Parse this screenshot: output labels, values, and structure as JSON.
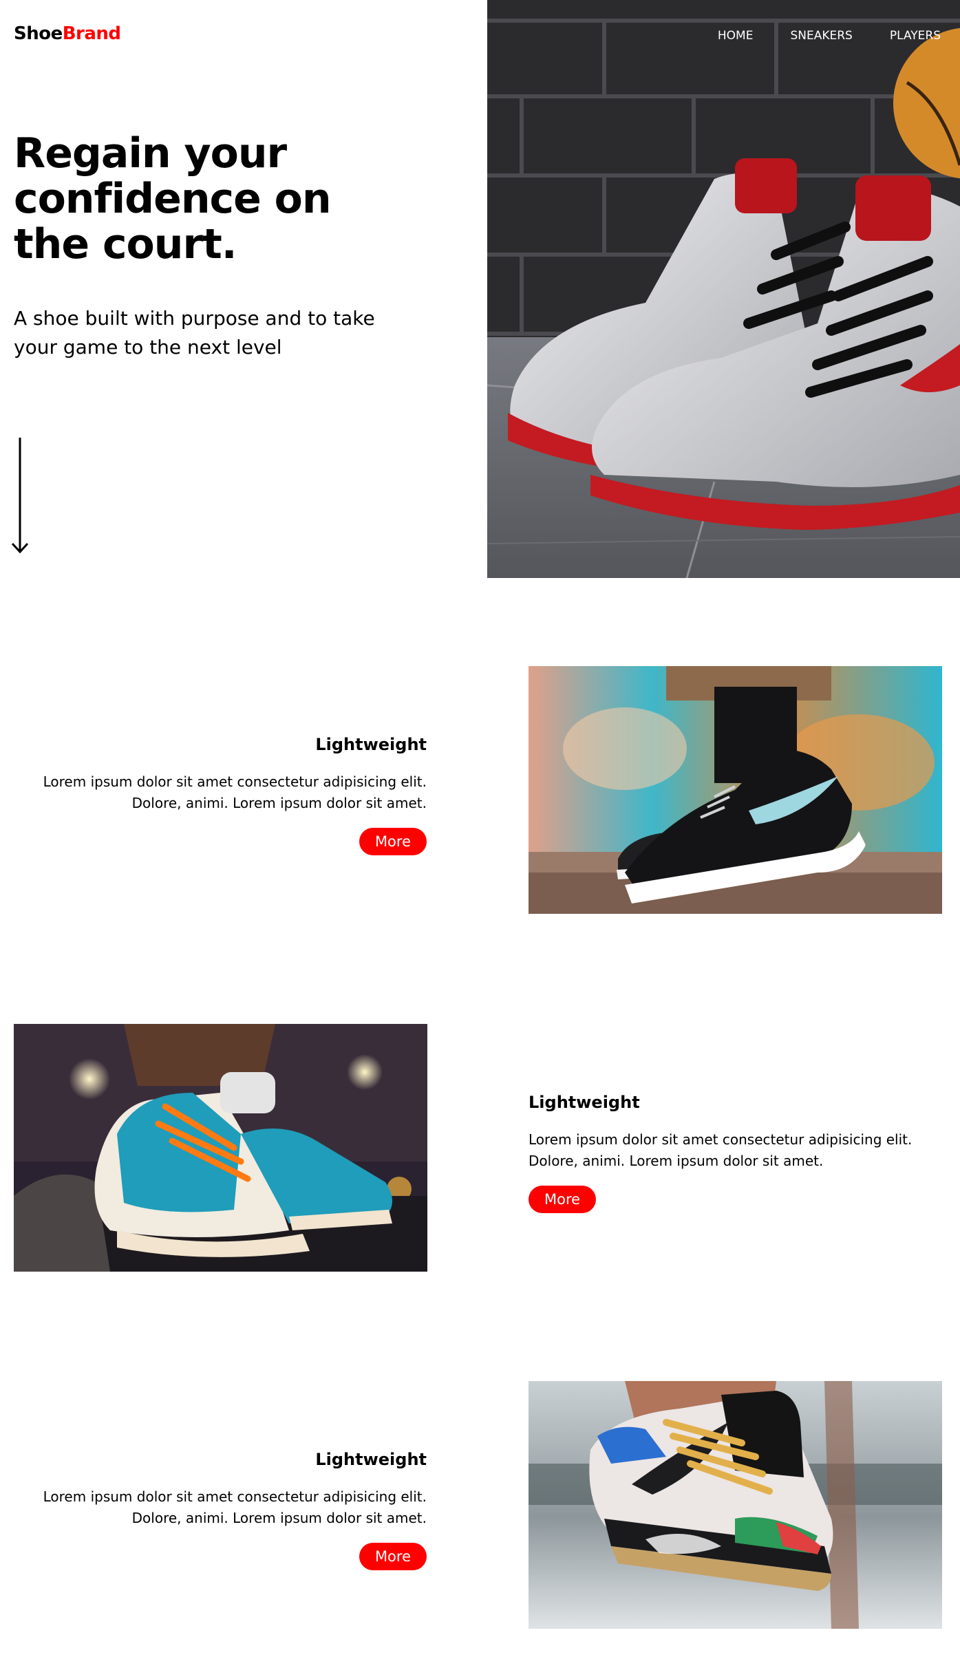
{
  "header": {
    "logo_part1": "Shoe",
    "logo_part2": "Brand",
    "nav": [
      "HOME",
      "SNEAKERS",
      "PLAYERS"
    ]
  },
  "hero": {
    "title": "Regain your confidence on the court.",
    "subtitle": "A shoe built with purpose and to take your game to the next level",
    "arrow_icon": "arrow-down-icon"
  },
  "features": [
    {
      "heading": "Lightweight",
      "body": "Lorem ipsum dolor sit amet consectetur adipisicing elit. Dolore, animi. Lorem ipsum dolor sit amet.",
      "button": "More"
    },
    {
      "heading": "Lightweight",
      "body": "Lorem ipsum dolor sit amet consectetur adipisicing elit. Dolore, animi. Lorem ipsum dolor sit amet.",
      "button": "More"
    },
    {
      "heading": "Lightweight",
      "body": "Lorem ipsum dolor sit amet consectetur adipisicing elit. Dolore, animi. Lorem ipsum dolor sit amet.",
      "button": "More"
    }
  ],
  "colors": {
    "accent": "#ff0000",
    "text": "#000000",
    "background": "#ffffff"
  }
}
